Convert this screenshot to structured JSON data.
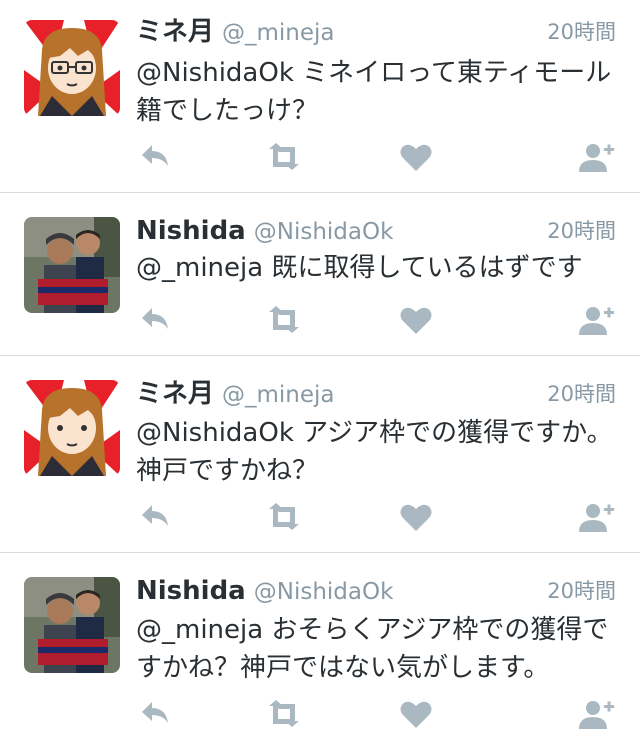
{
  "colors": {
    "icon": "#aab8c2",
    "name": "#292f33",
    "meta": "#8899a6",
    "separator": "#d8dde1"
  },
  "tweets": [
    {
      "name": "ミネ月",
      "handle": "@_mineja",
      "time": "20時間",
      "text": "@NishidaOk ミネイロって東ティモール籍でしたっけ？",
      "avatar": "anime-girl-avatar"
    },
    {
      "name": "Nishida",
      "handle": "@NishidaOk",
      "time": "20時間",
      "text": "@_mineja 既に取得しているはずです",
      "avatar": "two-men-photo-avatar"
    },
    {
      "name": "ミネ月",
      "handle": "@_mineja",
      "time": "20時間",
      "text": "@NishidaOk アジア枠での獲得ですか。神戸ですかね？",
      "avatar": "anime-girl-avatar"
    },
    {
      "name": "Nishida",
      "handle": "@NishidaOk",
      "time": "20時間",
      "text": "@_mineja おそらくアジア枠での獲得ですかね？神戸ではない気がします。",
      "avatar": "two-men-photo-avatar"
    }
  ],
  "action_icons": [
    "reply-icon",
    "retweet-icon",
    "like-icon",
    "follow-icon"
  ]
}
